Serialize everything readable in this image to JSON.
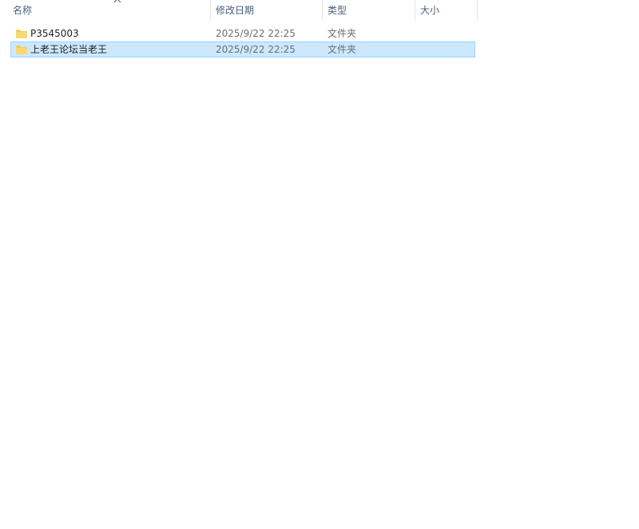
{
  "columns": {
    "name": "名称",
    "modified": "修改日期",
    "type": "类型",
    "size": "大小"
  },
  "sort": {
    "column": "name",
    "direction": "ascending",
    "indicator_icon": "chevron-up-icon"
  },
  "files": [
    {
      "name": "P3545003",
      "modified": "2025/9/22 22:25",
      "type": "文件夹",
      "size": "",
      "icon": "folder-icon",
      "selected": false
    },
    {
      "name": "上老王论坛当老王",
      "modified": "2025/9/22 22:25",
      "type": "文件夹",
      "size": "",
      "icon": "folder-icon",
      "selected": true
    }
  ],
  "colors": {
    "header_text": "#4c607a",
    "selection_fill": "#cce8ff",
    "selection_border": "#99d1ff",
    "folder_yellow": "#f8d775"
  }
}
